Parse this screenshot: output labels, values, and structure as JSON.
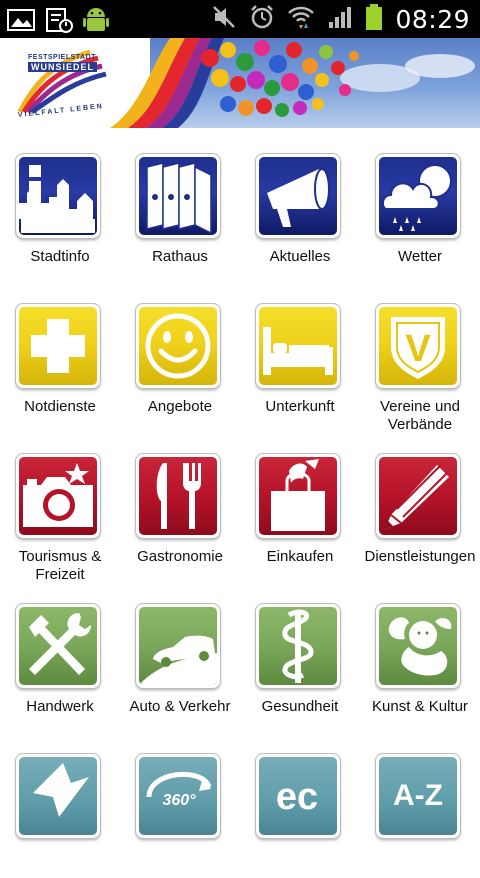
{
  "status_bar": {
    "time": "08:29",
    "left_icons": [
      "gallery-icon",
      "calendar-icon",
      "android-debug-icon"
    ],
    "right_icons": [
      "mute-icon",
      "alarm-icon",
      "wifi-icon",
      "signal-icon",
      "battery-icon"
    ],
    "battery_color": "#9bd12a"
  },
  "banner": {
    "logo_brand": "WUNSIEDEL",
    "logo_small": "FESTSPIELSTADT",
    "logo_slogan": "VIELFALT LEBEN"
  },
  "tiles": [
    {
      "label": "Stadtinfo",
      "icon": "city-info-icon",
      "color": "blue"
    },
    {
      "label": "Rathaus",
      "icon": "binders-icon",
      "color": "blue"
    },
    {
      "label": "Aktuelles",
      "icon": "megaphone-icon",
      "color": "blue"
    },
    {
      "label": "Wetter",
      "icon": "weather-cloud-icon",
      "color": "blue"
    },
    {
      "label": "Notdienste",
      "icon": "cross-icon",
      "color": "yellow"
    },
    {
      "label": "Angebote",
      "icon": "smiley-icon",
      "color": "yellow"
    },
    {
      "label": "Unterkunft",
      "icon": "bed-icon",
      "color": "yellow"
    },
    {
      "label": "Vereine und Verbände",
      "icon": "club-badge-icon",
      "color": "yellow"
    },
    {
      "label": "Tourismus & Freizeit",
      "icon": "camera-icon",
      "color": "red"
    },
    {
      "label": "Gastronomie",
      "icon": "knife-fork-icon",
      "color": "red"
    },
    {
      "label": "Einkaufen",
      "icon": "shopping-bag-icon",
      "color": "red"
    },
    {
      "label": "Dienstleistungen",
      "icon": "pencil-icon",
      "color": "red"
    },
    {
      "label": "Handwerk",
      "icon": "tools-icon",
      "color": "green"
    },
    {
      "label": "Auto & Verkehr",
      "icon": "car-icon",
      "color": "green"
    },
    {
      "label": "Gesundheit",
      "icon": "caduceus-icon",
      "color": "green"
    },
    {
      "label": "Kunst & Kultur",
      "icon": "cherub-icon",
      "color": "green"
    },
    {
      "label": "",
      "icon": "arrow-icon",
      "color": "teal"
    },
    {
      "label": "",
      "icon": "panorama-360-icon",
      "color": "teal"
    },
    {
      "label": "",
      "icon": "ec-card-icon",
      "color": "teal"
    },
    {
      "label": "",
      "icon": "a-z-index-icon",
      "color": "teal"
    }
  ],
  "icon_texts": {
    "info_letter": "i",
    "club_letter": "V",
    "pano": "360°",
    "ec": "ec",
    "az": "A-Z"
  }
}
